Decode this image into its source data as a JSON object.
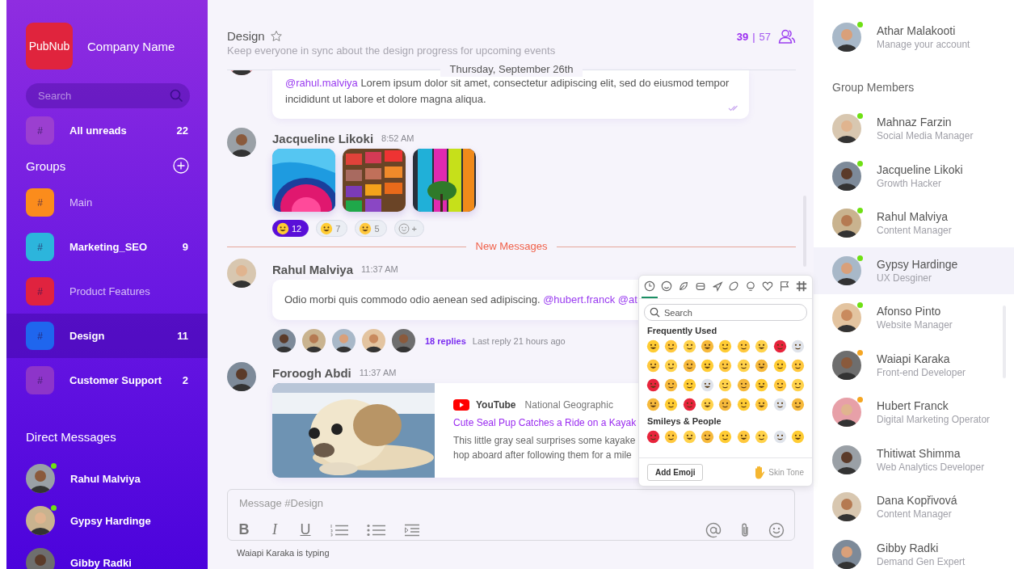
{
  "sidebar": {
    "logo": "PubNub",
    "company": "Company Name",
    "search": {
      "placeholder": "Search"
    },
    "all_unreads": {
      "tile": "#",
      "label": "All unreads",
      "count": "22",
      "color": "#9b3fd0"
    },
    "groups_title": "Groups",
    "groups": [
      {
        "tile": "#",
        "label": "Main",
        "color": "#fb8c1c",
        "unread": false,
        "selected": false
      },
      {
        "tile": "#",
        "label": "Marketing_SEO",
        "count": "9",
        "color": "#2cb5dc",
        "unread": true,
        "selected": false
      },
      {
        "tile": "#",
        "label": "Product Features",
        "color": "#e0233f",
        "unread": false,
        "selected": false
      },
      {
        "tile": "#",
        "label": "Design",
        "count": "11",
        "color": "#1f66ee",
        "unread": true,
        "selected": true
      },
      {
        "tile": "#",
        "label": "Customer Support",
        "count": "2",
        "color": "#8d35c9",
        "unread": true,
        "selected": false
      }
    ],
    "direct_title": "Direct Messages",
    "direct": [
      {
        "name": "Rahul Malviya",
        "online": true
      },
      {
        "name": "Gypsy Hardinge",
        "online": true
      },
      {
        "name": "Gibby Radki",
        "online": false
      }
    ]
  },
  "channel": {
    "title": "Design",
    "starred": false,
    "description": "Keep everyone in sync about the design progress for upcoming events",
    "online": "39",
    "separator": "|",
    "members": "57"
  },
  "date_divider": "Thursday, September 26th",
  "messages": [
    {
      "kind": "text",
      "mention": "@rahul.malviya",
      "text": " Lorem ipsum dolor sit amet, consectetur adipiscing elit, sed do eiusmod tempor incididunt ut labore et dolore magna aliqua.",
      "read": true
    },
    {
      "kind": "images",
      "author": "Jacqueline Likoki",
      "time": "8:52 AM",
      "images": [
        {
          "kind": "picture"
        },
        {
          "kind": "picture"
        },
        {
          "kind": "picture"
        }
      ],
      "reactions": [
        {
          "kind": "emoji",
          "count": "12",
          "selected": true
        },
        {
          "kind": "emoji",
          "count": "7",
          "selected": false
        },
        {
          "kind": "emoji",
          "count": "5",
          "selected": false
        },
        {
          "kind": "add",
          "count": "+",
          "selected": false
        }
      ]
    },
    {
      "kind": "divider",
      "label": "New Messages"
    },
    {
      "kind": "thread",
      "author": "Rahul Malviya",
      "time": "11:37 AM",
      "text": "Odio morbi quis commodo odio aenean sed adipiscing. ",
      "mention": "@hubert.franck @at",
      "replies": "18 replies",
      "last_reply": "Last reply 21 hours ago"
    },
    {
      "kind": "link",
      "author": "Foroogh Abdi",
      "time": "11:37 AM",
      "source": "YouTube",
      "channel": "National Geographic",
      "title": "Cute Seal Pup Catches a Ride on a Kayak",
      "description": [
        "This little gray seal surprises some kayake",
        "hop aboard after following them for a mile"
      ]
    }
  ],
  "composer": {
    "placeholder": "Message #Design",
    "format": [
      "B",
      "I",
      "U"
    ],
    "typing": "Waiapi Karaka is typing"
  },
  "emoji_picker": {
    "tabs": [
      {
        "selected": true
      },
      {
        "selected": false
      },
      {
        "selected": false
      },
      {
        "selected": false
      },
      {
        "selected": false
      },
      {
        "selected": false
      },
      {
        "selected": false
      },
      {
        "selected": false
      },
      {
        "selected": false
      },
      {
        "selected": false
      }
    ],
    "search": {
      "placeholder": "Search"
    },
    "sections": [
      "Frequently Used",
      "Smileys & People"
    ],
    "add_button": "Add Emoji",
    "skin_tone": "Skin Tone"
  },
  "account": {
    "name": "Athar Malakooti",
    "subtitle": "Manage your account",
    "color": "#6fe014"
  },
  "members_title": "Group Members",
  "members": [
    {
      "name": "Mahnaz Farzin",
      "role": "Social Media Manager",
      "color": "#6fe014",
      "selected": false
    },
    {
      "name": "Jacqueline Likoki",
      "role": "Growth Hacker",
      "color": "#6fe014",
      "selected": false
    },
    {
      "name": "Rahul Malviya",
      "role": "Content Manager",
      "color": "#6fe014",
      "selected": false
    },
    {
      "name": "Gypsy Hardinge",
      "role": "UX Desginer",
      "color": "#6fe014",
      "selected": true
    },
    {
      "name": "Afonso Pinto",
      "role": "Website Manager",
      "color": "#6fe014",
      "selected": false
    },
    {
      "name": "Waiapi Karaka",
      "role": "Front-end Developer",
      "color": "#f5a623",
      "selected": false
    },
    {
      "name": "Hubert Franck",
      "role": "Digital Marketing Operator",
      "color": "#f5a623",
      "selected": false
    },
    {
      "name": "Thitiwat Shimma",
      "role": "Web Analytics Developer",
      "selected": false
    },
    {
      "name": "Dana Kopřivová",
      "role": "Content Manager",
      "selected": false
    },
    {
      "name": "Gibby Radki",
      "role": "Demand Gen Expert",
      "selected": false
    }
  ]
}
